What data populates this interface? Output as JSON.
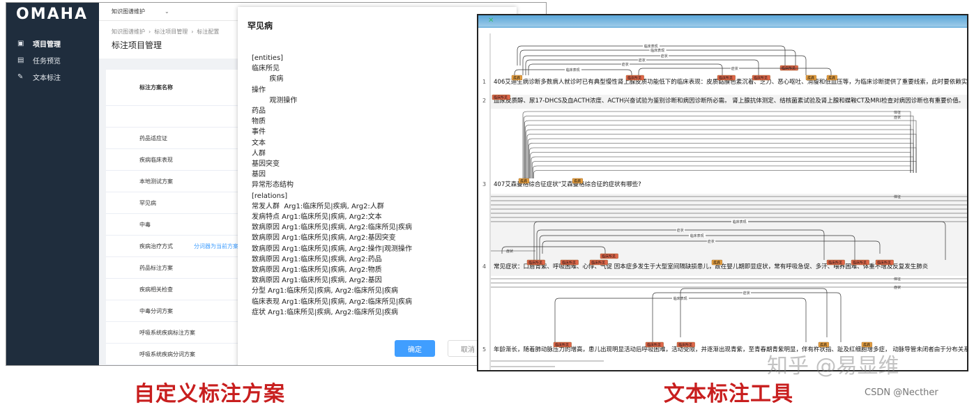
{
  "left": {
    "logo": "OMAHA",
    "topbar_select": "知识图谱维护",
    "nav": [
      {
        "label": "项目管理",
        "icon": "folder-icon",
        "active": true
      },
      {
        "label": "任务预览",
        "icon": "grid-icon",
        "active": false
      },
      {
        "label": "文本标注",
        "icon": "edit-icon",
        "active": false
      }
    ],
    "breadcrumb": [
      "知识图谱维护",
      "标注项目管理",
      "标注配置"
    ],
    "page_title": "标注项目管理",
    "table_header": "标注方案名称",
    "rows": [
      {
        "name": ""
      },
      {
        "name": "药品适应证"
      },
      {
        "name": "疾病临床表现"
      },
      {
        "name": "本地测试方案"
      },
      {
        "name": "罕见病"
      },
      {
        "name": "中毒"
      },
      {
        "name": "疾病治疗方式",
        "action": "分词器为当前方案"
      },
      {
        "name": "药品标注方案"
      },
      {
        "name": "疾病相关检查"
      },
      {
        "name": "中毒分词方案"
      },
      {
        "name": "呼吸系统疾病标注方案"
      },
      {
        "name": "呼吸系统疾病分词方案"
      }
    ],
    "modal": {
      "title": "罕见病",
      "lines": [
        "[entities]",
        "临床所见",
        "        疾病",
        "操作",
        "        观测操作",
        "药品",
        "物质",
        "事件",
        "文本",
        "人群",
        "基因突变",
        "基因",
        "异常形态结构",
        "[relations]",
        "常发人群  Arg1:临床所见|疾病, Arg2:人群",
        "发病特点 Arg1:临床所见|疾病, Arg2:文本",
        "致病原因 Arg1:临床所见|疾病, Arg2:临床所见|疾病",
        "致病原因 Arg1:临床所见|疾病, Arg2:基因突变",
        "致病原因 Arg1:临床所见|疾病, Arg2:操作|观测操作",
        "致病原因 Arg1:临床所见|疾病, Arg2:药品",
        "致病原因 Arg1:临床所见|疾病, Arg2:物质",
        "致病原因 Arg1:临床所见|疾病, Arg2:基因",
        "分型 Arg1:临床所见|疾病, Arg2:临床所见|疾病",
        "临床表现 Arg1:临床所见|疾病, Arg2:临床所见|疾病",
        "症状 Arg1:临床所见|疾病, Arg2:临床所见|疾病"
      ],
      "ok": "确定",
      "cancel": "取消"
    }
  },
  "right": {
    "close_symbol": "✕",
    "sentences": [
      {
        "num": "1",
        "text": "406艾迪生病诊断多数病人就诊时已有典型慢性肾上腺皮质功能低下的临床表现：皮质黏膜色素沉着、乏力、恶心呕吐、消瘦和低血压等，为临床诊断提供了重要线索，此时要依赖实验"
      },
      {
        "num": "2",
        "text": "血尿皮质醇、尿17-DHCS及血ACTH浓度、ACTH兴奋试验为鉴别诊断和病因诊断所必需。 肾上腺抗体测定、结核菌素试验及肾上腺和蝶鞍CT及MRI检查对病因诊断也有重要价值。"
      },
      {
        "num": "3",
        "text": "407艾森曼格综合征症状\"艾森曼格综合征的症状有哪些?"
      },
      {
        "num": "4",
        "text": "常见症状：口唇青紫、呼吸困难、心悸、气促          因本症多发生于大型室间隔缺损患儿，故在婴儿期即显症状，常有呼吸急促、多汗、喂养困难、体重不增及反复发生肺炎"
      },
      {
        "num": "5",
        "text": "年龄渐长，随着肺动脉压力的增高，患儿出现明显活动后呼吸困难，活动受限，并逐渐出现青紫，至青春期青紫明显，伴有杵状指、趾及红细胞增多症，    动脉导管未闭者由于分布关系"
      }
    ],
    "entities": [
      "疾病",
      "临床所见",
      "临床所见",
      "临床所见",
      "临床所见",
      "疾病",
      "疾病",
      "临床所见",
      "疾病",
      "疾病",
      "临床所见",
      "临床所见",
      "临床所见",
      "临床所见",
      "疾病",
      "临床所见",
      "临床所见",
      "临床所见",
      "临床所见",
      "临床所见",
      "临床所见",
      "疾病",
      "疾病"
    ],
    "arc_labels": [
      "临床表现",
      "临床表现",
      "症状",
      "症状",
      "症状",
      "临床表现",
      "症状",
      "体征",
      "症状",
      "临床表现",
      "症状",
      "临床表现",
      "症状",
      "症状",
      "体征",
      "临床表现",
      "症状",
      "体征",
      "症状"
    ]
  },
  "captions": {
    "left": "自定义标注方案",
    "right": "文本标注工具"
  },
  "watermark": "知乎 @易显维",
  "credit": "CSDN @Necther",
  "colors": {
    "sidebar": "#1f2d3d",
    "primary": "#409eff",
    "caption": "#c81e1e",
    "disease_entity": "#e8a040",
    "finding_entity": "#e0664a"
  }
}
